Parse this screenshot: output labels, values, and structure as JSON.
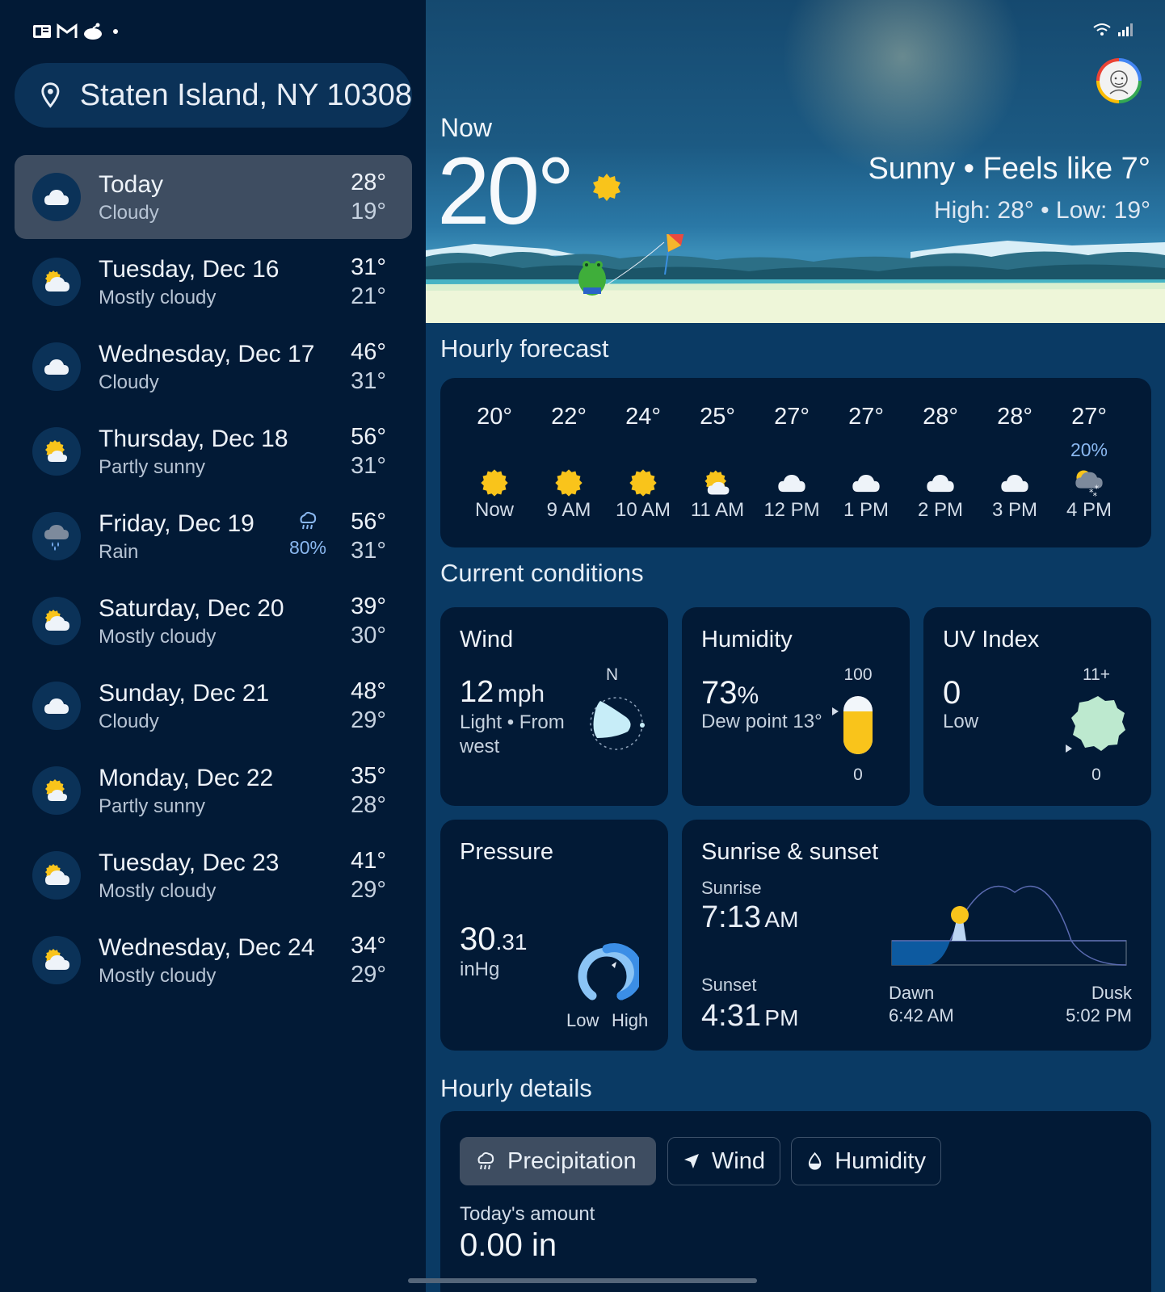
{
  "sidebar": {
    "location": "Staten Island, NY 10308",
    "days": [
      {
        "name": "Today",
        "condition": "Cloudy",
        "high": "28°",
        "low": "19°",
        "icon": "cloudy-icon",
        "selected": true
      },
      {
        "name": "Tuesday, Dec 16",
        "condition": "Mostly cloudy",
        "high": "31°",
        "low": "21°",
        "icon": "mostly-cloudy-icon"
      },
      {
        "name": "Wednesday, Dec 17",
        "condition": "Cloudy",
        "high": "46°",
        "low": "31°",
        "icon": "cloudy-icon"
      },
      {
        "name": "Thursday, Dec 18",
        "condition": "Partly sunny",
        "high": "56°",
        "low": "31°",
        "icon": "partly-sunny-icon"
      },
      {
        "name": "Friday, Dec 19",
        "condition": "Rain",
        "high": "56°",
        "low": "31°",
        "icon": "rain-icon",
        "precip": "80%"
      },
      {
        "name": "Saturday, Dec 20",
        "condition": "Mostly cloudy",
        "high": "39°",
        "low": "30°",
        "icon": "mostly-cloudy-icon"
      },
      {
        "name": "Sunday, Dec 21",
        "condition": "Cloudy",
        "high": "48°",
        "low": "29°",
        "icon": "cloudy-icon"
      },
      {
        "name": "Monday, Dec 22",
        "condition": "Partly sunny",
        "high": "35°",
        "low": "28°",
        "icon": "partly-sunny-icon"
      },
      {
        "name": "Tuesday, Dec 23",
        "condition": "Mostly cloudy",
        "high": "41°",
        "low": "29°",
        "icon": "mostly-cloudy-icon"
      },
      {
        "name": "Wednesday, Dec 24",
        "condition": "Mostly cloudy",
        "high": "34°",
        "low": "29°",
        "icon": "mostly-cloudy-icon"
      }
    ]
  },
  "now": {
    "label": "Now",
    "temp": "20°",
    "condition_line": "Sunny • Feels like 7°",
    "hilo_line": "High: 28° • Low: 19°"
  },
  "hourly": {
    "title": "Hourly forecast",
    "items": [
      {
        "temp": "20°",
        "label": "Now",
        "icon": "sunny-icon"
      },
      {
        "temp": "22°",
        "label": "9 AM",
        "icon": "sunny-icon"
      },
      {
        "temp": "24°",
        "label": "10 AM",
        "icon": "sunny-icon"
      },
      {
        "temp": "25°",
        "label": "11 AM",
        "icon": "partly-sunny-icon"
      },
      {
        "temp": "27°",
        "label": "12 PM",
        "icon": "cloudy-icon"
      },
      {
        "temp": "27°",
        "label": "1 PM",
        "icon": "cloudy-icon"
      },
      {
        "temp": "28°",
        "label": "2 PM",
        "icon": "cloudy-icon"
      },
      {
        "temp": "28°",
        "label": "3 PM",
        "icon": "cloudy-icon"
      },
      {
        "temp": "27°",
        "label": "4 PM",
        "icon": "snow-icon",
        "precip": "20%"
      }
    ]
  },
  "conditions": {
    "title": "Current conditions",
    "wind": {
      "title": "Wind",
      "speed": "12",
      "unit": "mph",
      "desc": "Light • From west",
      "compass": "N"
    },
    "humidity": {
      "title": "Humidity",
      "value": "73",
      "unit": "%",
      "dew": "Dew point 13°",
      "max": "100",
      "min": "0",
      "level": 0.73
    },
    "uv": {
      "title": "UV Index",
      "value": "0",
      "desc": "Low",
      "max": "11+",
      "min": "0"
    },
    "pressure": {
      "title": "Pressure",
      "value": "30",
      "decimal": ".31",
      "unit": "inHg",
      "low": "Low",
      "high": "High"
    },
    "sun": {
      "title": "Sunrise & sunset",
      "sunrise_label": "Sunrise",
      "sunrise_time": "7:13",
      "sunrise_ampm": "AM",
      "sunset_label": "Sunset",
      "sunset_time": "4:31",
      "sunset_ampm": "PM",
      "dawn_label": "Dawn",
      "dawn_time": "6:42 AM",
      "dusk_label": "Dusk",
      "dusk_time": "5:02 PM"
    }
  },
  "details": {
    "title": "Hourly details",
    "tabs": [
      "Precipitation",
      "Wind",
      "Humidity"
    ],
    "amount_label": "Today's amount",
    "amount_value": "0.00 in"
  },
  "colors": {
    "sun": "#f9c41b",
    "accent_blue": "#8ab8f0",
    "card_bg": "#021a36"
  }
}
